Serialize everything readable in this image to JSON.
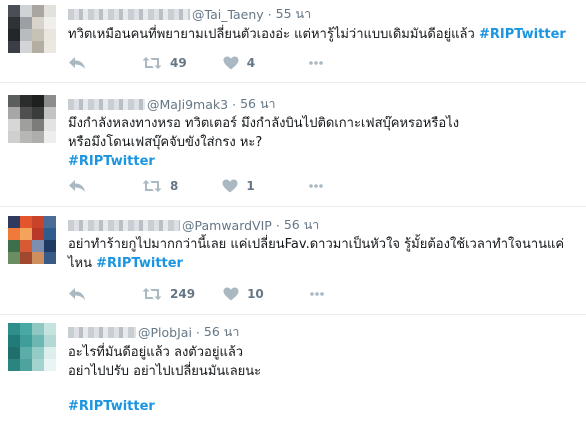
{
  "tweets": [
    {
      "handle": "@Tai_Taeny",
      "separator": "·",
      "time": "55 นา",
      "text": "ทวิตเหมือนคนที่พยายามเปลี่ยนตัวเองอ่ะ แต่หารู้ไม่ว่าแบบเดิมมันดีอยู่แล้ว",
      "hashtag": "#RIPTwitter",
      "retweets": "49",
      "likes": "4",
      "avatar_colors": [
        "#4a4f55",
        "#cfd3d6",
        "#a9a6a1",
        "#e3e1dc",
        "#2f3237",
        "#9aa0a4",
        "#d8d4cc",
        "#f1efeb",
        "#23262a",
        "#b9bcbe",
        "#c8c2b6",
        "#eae6df",
        "#3b3e44",
        "#d2d4d5",
        "#b4ada1",
        "#ebe8e2"
      ]
    },
    {
      "handle": "@MaJi9mak3",
      "separator": "·",
      "time": "56 นา",
      "text_line1": "มึงกำลังหลงทางหรอ ทวิตเตอร์ มึงกำลังบินไปติดเกาะเฟสบุ๊คหรอหรือไง",
      "text_line2": "หรือมึงโดนเฟสบุ๊คจับขังใส่กรง หะ?",
      "hashtag": "#RIPTwitter",
      "retweets": "8",
      "likes": "1",
      "avatar_colors": [
        "#5b5e5e",
        "#2b2c2c",
        "#1e1f1f",
        "#8b8d8d",
        "#a7a8a6",
        "#4e4f4e",
        "#3a3b3b",
        "#c3c4c2",
        "#d7d8d6",
        "#9fa09d",
        "#7c7d7a",
        "#e3e4e2",
        "#cfd0ce",
        "#b7b8b5",
        "#aeafac",
        "#eeeeec"
      ]
    },
    {
      "handle": "@PamwardVIP",
      "separator": "·",
      "time": "56 นา",
      "text_line1": "อย่าทำร้ายกูไปมากกว่านี้เลย แค่เปลี่ยนFav.ดาวมาเป็นหัวใจ รู้มั้ยต้องใช้เวลาทำใจนานแค่",
      "text_line2_prefix": "ไหน ",
      "hashtag": "#RIPTwitter",
      "retweets": "249",
      "likes": "10",
      "avatar_colors": [
        "#2f3a5e",
        "#e2552d",
        "#c7432a",
        "#4a6d97",
        "#ef7a3a",
        "#f3a35b",
        "#b8392a",
        "#2d5d8c",
        "#3c6f4c",
        "#d65a33",
        "#7c8fb0",
        "#1f3b64",
        "#6a8d62",
        "#a2482f",
        "#cf8e5d",
        "#385a86"
      ]
    },
    {
      "handle": "@PlobJai",
      "separator": "·",
      "time": "56 นา",
      "text_line1": "อะไรที่มันดีอยู่แล้ว ลงตัวอยู่แล้ว",
      "text_line2": "อย่าไปปรับ อย่าไปเปลี่ยนมันเลยนะ",
      "hashtag": "#RIPTwitter",
      "avatar_colors": [
        "#2e8f8a",
        "#48a9a4",
        "#8fc8c3",
        "#c7e3e0",
        "#227b78",
        "#3f9e99",
        "#6cb7b2",
        "#b2d9d5",
        "#1f6f6d",
        "#5aada8",
        "#93ccc7",
        "#dcefed",
        "#2a8480",
        "#4fa39e",
        "#a4d2ce",
        "#e8f5f4"
      ]
    }
  ],
  "icons": {
    "reply": "reply-icon",
    "retweet": "retweet-icon",
    "like": "heart-icon",
    "more": "more-icon"
  },
  "colors": {
    "hashtag": "#1b95e0",
    "meta": "#657786",
    "action_icon": "#aab8c2"
  }
}
